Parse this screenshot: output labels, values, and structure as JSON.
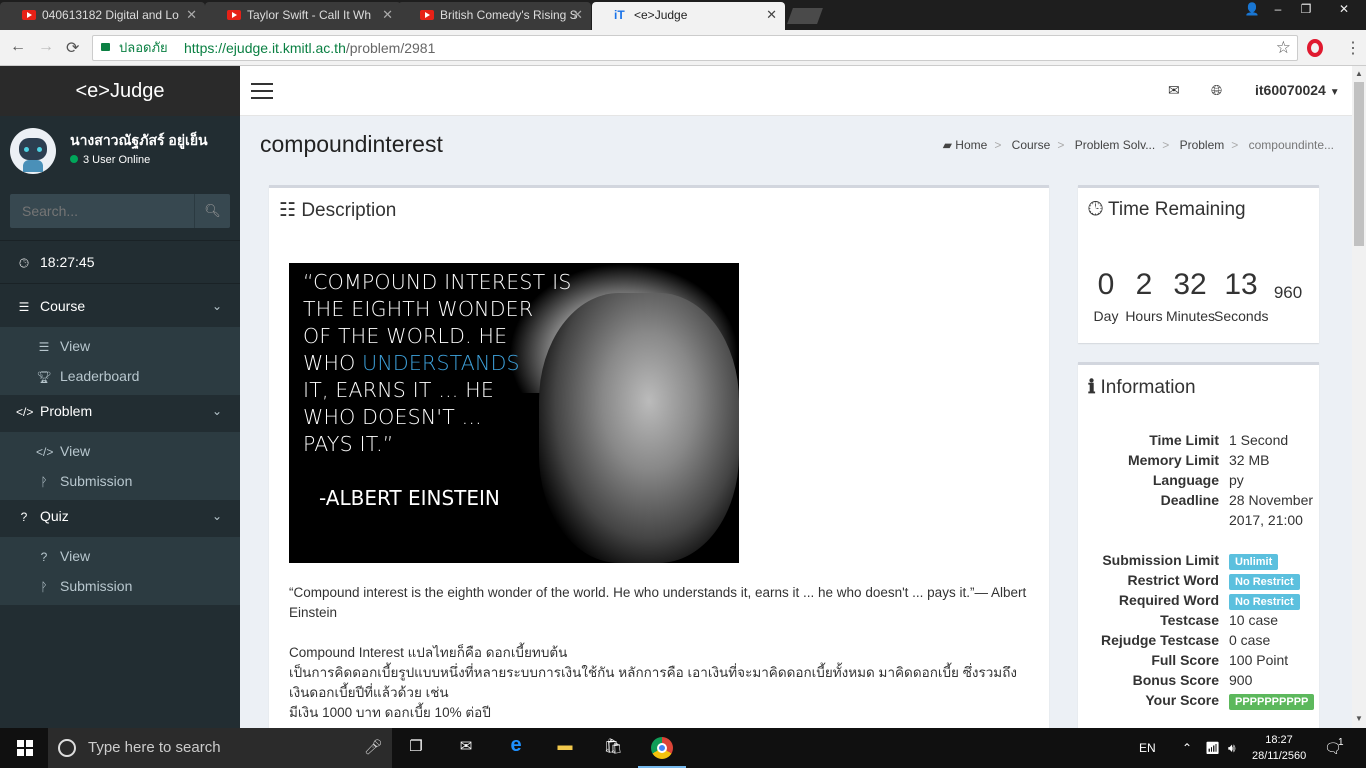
{
  "browser": {
    "tabs": [
      {
        "title": "040613182 Digital and Lo",
        "type": "youtube"
      },
      {
        "title": "Taylor Swift - Call It Wh",
        "type": "youtube"
      },
      {
        "title": "British Comedy's Rising S",
        "type": "youtube"
      },
      {
        "title": "<e>Judge",
        "type": "site"
      }
    ],
    "secure_label": "ปลอดภัย",
    "url_host": "https://ejudge.it.kmitl.ac.th",
    "url_path": "/problem/2981"
  },
  "sidebar": {
    "brand": "<e>Judge",
    "user_name": "นางสาวณัฐภัสร์ อยู่เย็น",
    "online": "3 User Online",
    "search_placeholder": "Search...",
    "clock": "18:27:45",
    "sections": [
      {
        "title": "Course",
        "items": [
          "View",
          "Leaderboard"
        ]
      },
      {
        "title": "Problem",
        "items": [
          "View",
          "Submission"
        ]
      },
      {
        "title": "Quiz",
        "items": [
          "View",
          "Submission"
        ]
      }
    ]
  },
  "topnav": {
    "username": "it60070024"
  },
  "page": {
    "title": "compoundinterest",
    "breadcrumb": [
      "Home",
      "Course",
      "Problem Solv...",
      "Problem",
      "compoundinte..."
    ]
  },
  "description": {
    "title": "Description",
    "image_quote_lines": [
      "“COMPOUND INTEREST IS",
      "THE EIGHTH WONDER",
      "OF THE WORLD. HE",
      "WHO",
      "UNDERSTANDS",
      "IT, EARNS IT ... HE",
      "WHO DOESN'T ...",
      "PAYS IT.”"
    ],
    "image_author": "-ALBERT EINSTEIN",
    "quote_text": "“Compound interest is the eighth wonder of the world. He who understands it, earns it ... he who doesn't ... pays it.”— Albert Einstein",
    "para1": "Compound Interest แปลไทยก็คือ ดอกเบี้ยทบต้น",
    "para2": "เป็นการคิดดอกเบี้ยรูปแบบหนึ่งที่หลายระบบการเงินใช้กัน หลักการคือ เอาเงินที่จะมาคิดดอกเบี้ยทั้งหมด มาคิดดอกเบี้ย ซึ่งรวมถึงเงินดอกเบี้ยปีที่แล้วด้วย เช่น",
    "para3": "มีเงิน 1000 บาท ดอกเบี้ย 10% ต่อปี"
  },
  "time_remaining": {
    "title": "Time Remaining",
    "day": "0",
    "hours": "2",
    "minutes": "32",
    "seconds": "13",
    "ms": "960",
    "day_label": "Day",
    "hours_label": "Hours",
    "minutes_label": "Minutes",
    "seconds_label": "Seconds"
  },
  "information": {
    "title": "Information",
    "rows": [
      {
        "key": "Time Limit",
        "value": "1 Second"
      },
      {
        "key": "Memory Limit",
        "value": "32 MB"
      },
      {
        "key": "Language",
        "value": "py"
      },
      {
        "key": "Deadline",
        "value": "28 November 2017, 21:00"
      },
      {
        "key": "Submission Limit",
        "value": "Unlimit",
        "badge": "blue"
      },
      {
        "key": "Restrict Word",
        "value": "No Restrict",
        "badge": "blue"
      },
      {
        "key": "Required Word",
        "value": "No Restrict",
        "badge": "blue"
      },
      {
        "key": "Testcase",
        "value": "10 case"
      },
      {
        "key": "Rejudge Testcase",
        "value": "0 case"
      },
      {
        "key": "Full Score",
        "value": "100 Point"
      },
      {
        "key": "Bonus Score",
        "value": "900"
      },
      {
        "key": "Your Score",
        "value": "PPPPPPPPPP",
        "badge": "green"
      }
    ]
  },
  "taskbar": {
    "search_placeholder": "Type here to search",
    "lang": "EN",
    "time": "18:27",
    "date": "28/11/2560",
    "notif_count": "1"
  },
  "colors": {
    "sidebar_bg": "#222d32",
    "accent_blue": "#5bc0de",
    "score_green": "#5cb85c"
  }
}
